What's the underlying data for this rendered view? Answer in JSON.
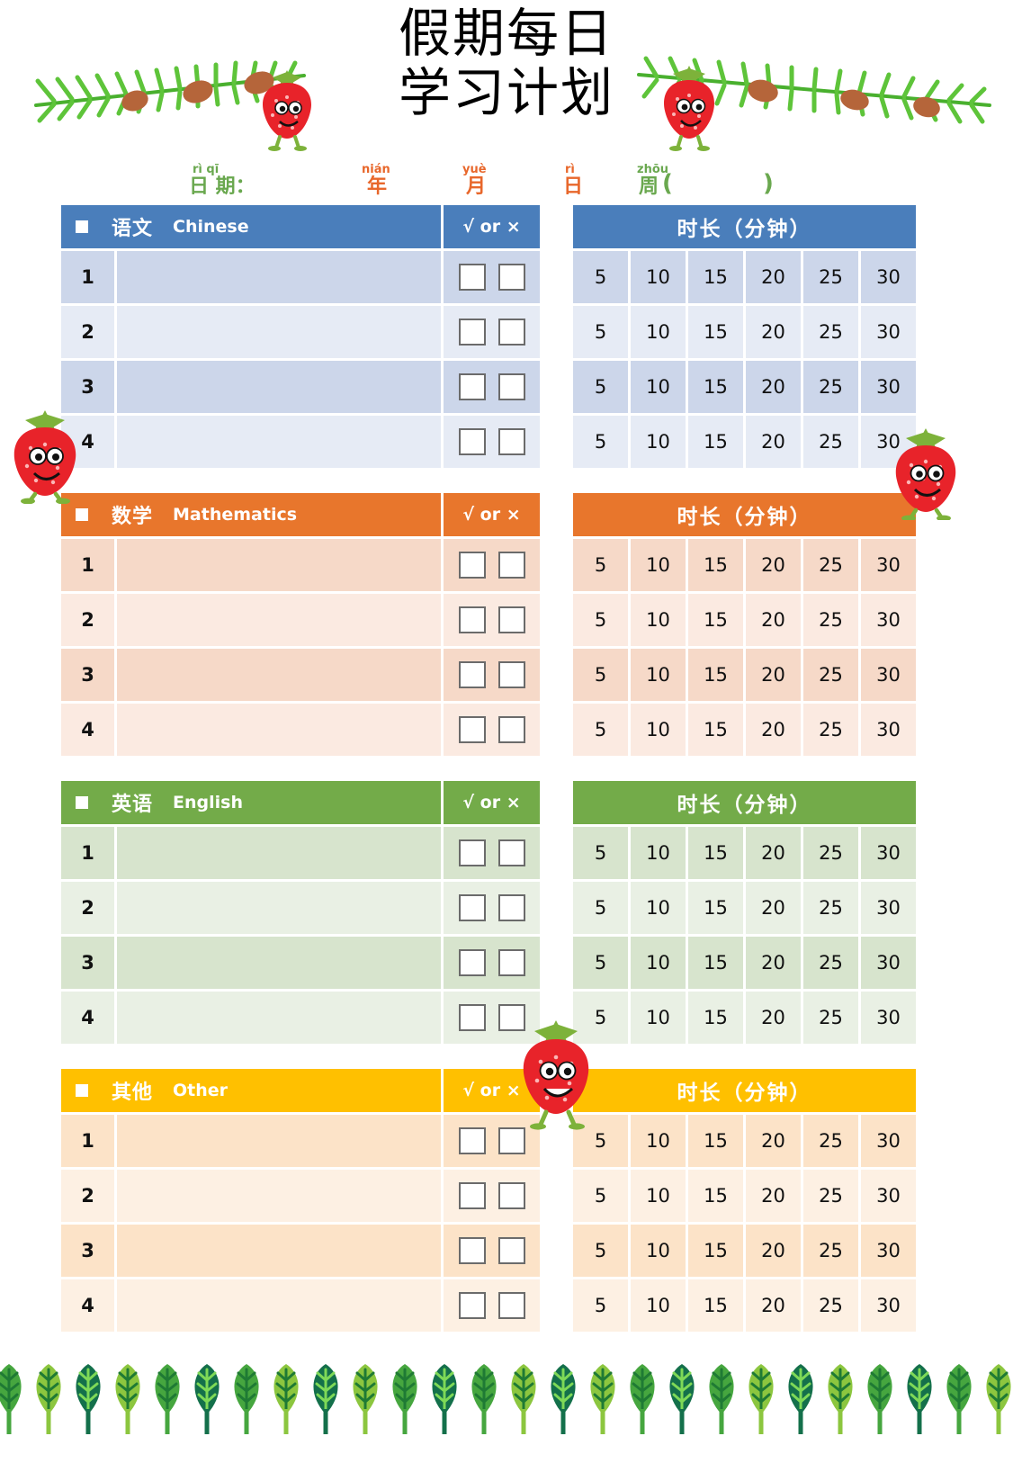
{
  "title": {
    "line1": "假期每日",
    "line2": "学习计划"
  },
  "date_line": {
    "label_pinyin": "rì  qī",
    "label": "日 期：",
    "year_pinyin": "nián",
    "year": "年",
    "month_pinyin": "yuè",
    "month": "月",
    "day_pinyin": "rì",
    "day": "日",
    "week_pinyin": "zhōu",
    "week": "周",
    "paren_open": "(",
    "paren_close": ")"
  },
  "common": {
    "check_header": "√  or  ×",
    "duration_header": "时长（分钟）",
    "minutes": [
      "5",
      "10",
      "15",
      "20",
      "25",
      "30"
    ],
    "row_numbers": [
      "1",
      "2",
      "3",
      "4"
    ]
  },
  "sections": [
    {
      "cn": "语文",
      "en": "Chinese",
      "header_color": "#4a7ebb",
      "row_odd": "#ccd6ea",
      "row_even": "#e6ebf5"
    },
    {
      "cn": "数学",
      "en": "Mathematics",
      "header_color": "#e8762c",
      "row_odd": "#f6d9c8",
      "row_even": "#fbeae1"
    },
    {
      "cn": "英语",
      "en": "English",
      "header_color": "#73ab49",
      "row_odd": "#d7e4cd",
      "row_even": "#e9f0e4"
    },
    {
      "cn": "其他",
      "en": "Other",
      "header_color": "#ffc000",
      "row_odd": "#fce3c8",
      "row_even": "#fdf0e3"
    }
  ],
  "decorations": {
    "pine_branch": "pine-branch-icon",
    "pine_cone": "pine-cone-icon",
    "strawberry": "strawberry-mascot-icon",
    "leaf_border": "leaf-border-icon"
  },
  "colors": {
    "pinyin_green": "#6aa84f",
    "pinyin_orange": "#e8672b",
    "leaf_dark": "#14704b",
    "leaf_mid": "#46a63f",
    "leaf_light": "#8cc63f"
  }
}
